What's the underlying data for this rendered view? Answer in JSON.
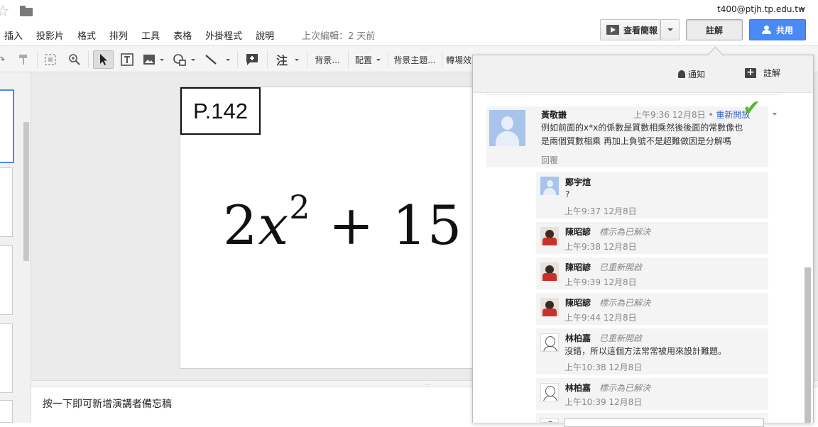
{
  "header": {
    "menu": [
      "插入",
      "投影片",
      "格式",
      "排列",
      "工具",
      "表格",
      "外掛程式",
      "說明"
    ],
    "last_edit": "上次編輯：2 天前",
    "user_email": "t400@ptjh.tp.edu.tw",
    "present_label": "查看簡報",
    "comments_label": "註解",
    "share_label": "共用"
  },
  "toolbar": {
    "insert_comment_label": "注",
    "background_label": "背景...",
    "layout_label": "配置",
    "theme_label": "背景主題...",
    "transition_label": "轉場效"
  },
  "slide": {
    "page_label": "P.142",
    "formula_coef": "2",
    "formula_var": "x",
    "formula_exp": "2",
    "formula_rest": "+ 15"
  },
  "notes": {
    "placeholder": "按一下即可新增演講者備忘稿"
  },
  "panel": {
    "notifications_label": "通知",
    "add_comment_label": "註解",
    "thread": {
      "author": "黃敬謙",
      "time": "上午9:36 12月8日",
      "reopen_label": "重新開放",
      "text_line1": "例如前面的x*x的係數是質數相乘然後後面的常數像也",
      "text_line2": "是兩個質數相乘 再加上負號不是超難做因是分解嗎",
      "reply_label": "回覆"
    },
    "replies": [
      {
        "author": "鄭宇煊",
        "status": "",
        "text": "?",
        "time": "上午9:37 12月8日"
      },
      {
        "author": "陳昭諺",
        "status": "標示為已解決",
        "text": "",
        "time": "上午9:38 12月8日"
      },
      {
        "author": "陳昭諺",
        "status": "已重新開啟",
        "text": "",
        "time": "上午9:39 12月8日"
      },
      {
        "author": "陳昭諺",
        "status": "標示為已解決",
        "text": "",
        "time": "上午9:44 12月8日"
      },
      {
        "author": "林柏嘉",
        "status": "已重新開啟",
        "text": "沒錯，所以這個方法常常被用來設計難題。",
        "time": "上午10:38 12月8日"
      },
      {
        "author": "林柏嘉",
        "status": "標示為已解決",
        "text": "",
        "time": "上午10:39 12月8日"
      }
    ]
  },
  "colors": {
    "accent": "#4a8af4",
    "resolve_check": "#5cb531",
    "link": "#3366cc"
  }
}
